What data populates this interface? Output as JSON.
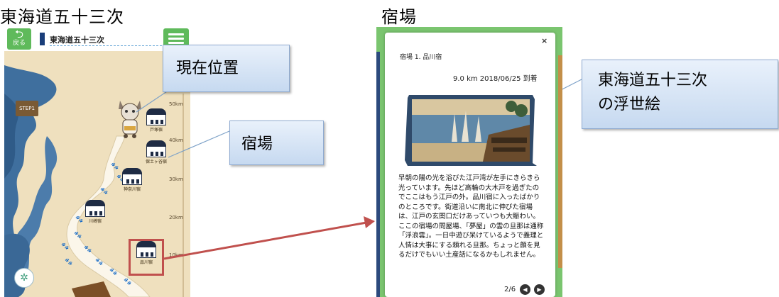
{
  "headings": {
    "left": "東海道五十三次",
    "right": "宿場"
  },
  "app": {
    "back_label": "戻る",
    "title": "東海道五十三次",
    "step_label": "STEP1"
  },
  "map": {
    "km_marks": [
      "50km",
      "40km",
      "30km",
      "20km",
      "10km"
    ],
    "stations": [
      "戸塚宿",
      "保土ヶ谷宿",
      "神奈川宿",
      "川崎宿",
      "品川宿"
    ]
  },
  "callouts": {
    "current_position": "現在位置",
    "shukuba": "宿場",
    "ukiyoe_line1": "東海道五十三次",
    "ukiyoe_line2": "の浮世絵"
  },
  "card": {
    "close": "×",
    "title": "宿場 1. 品川宿",
    "meta": "9.0 km  2018/06/25  到着",
    "body": "早朝の陽の光を浴びた江戸湾が左手にきらきら光っています。先ほど高輪の大木戸を過ぎたのでここはもう江戸の外。品川宿に入ったばかりのところです。街道沿いに南北に伸びた宿場は、江戸の玄関口だけあっていつも大賑わい。ここの宿場の問屋場、「夢屋」の雲の旦那は通称「浮浪雲」。一日中遊び呆けているようで義理と人情は大事にする頼れる旦那。ちょっと顔を見るだけでもいい土産話になるかもしれません。",
    "pager": "2/6"
  },
  "colors": {
    "accent_green": "#5fba5b",
    "callout_fill": "#c6d9f0",
    "highlight_red": "#c0504d",
    "arrow_red": "#c0504d"
  }
}
